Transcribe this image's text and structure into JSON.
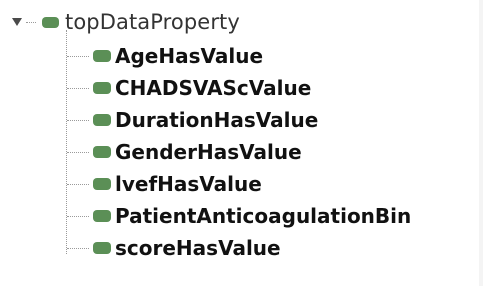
{
  "tree": {
    "root": {
      "label": "topDataProperty",
      "expanded": true,
      "swatch_color": "#5b8f56"
    },
    "children": [
      {
        "label": "AgeHasValue"
      },
      {
        "label": "CHADSVAScValue"
      },
      {
        "label": "DurationHasValue"
      },
      {
        "label": "GenderHasValue"
      },
      {
        "label": "lvefHasValue"
      },
      {
        "label": "PatientAnticoagulationBin"
      },
      {
        "label": "scoreHasValue"
      }
    ]
  }
}
